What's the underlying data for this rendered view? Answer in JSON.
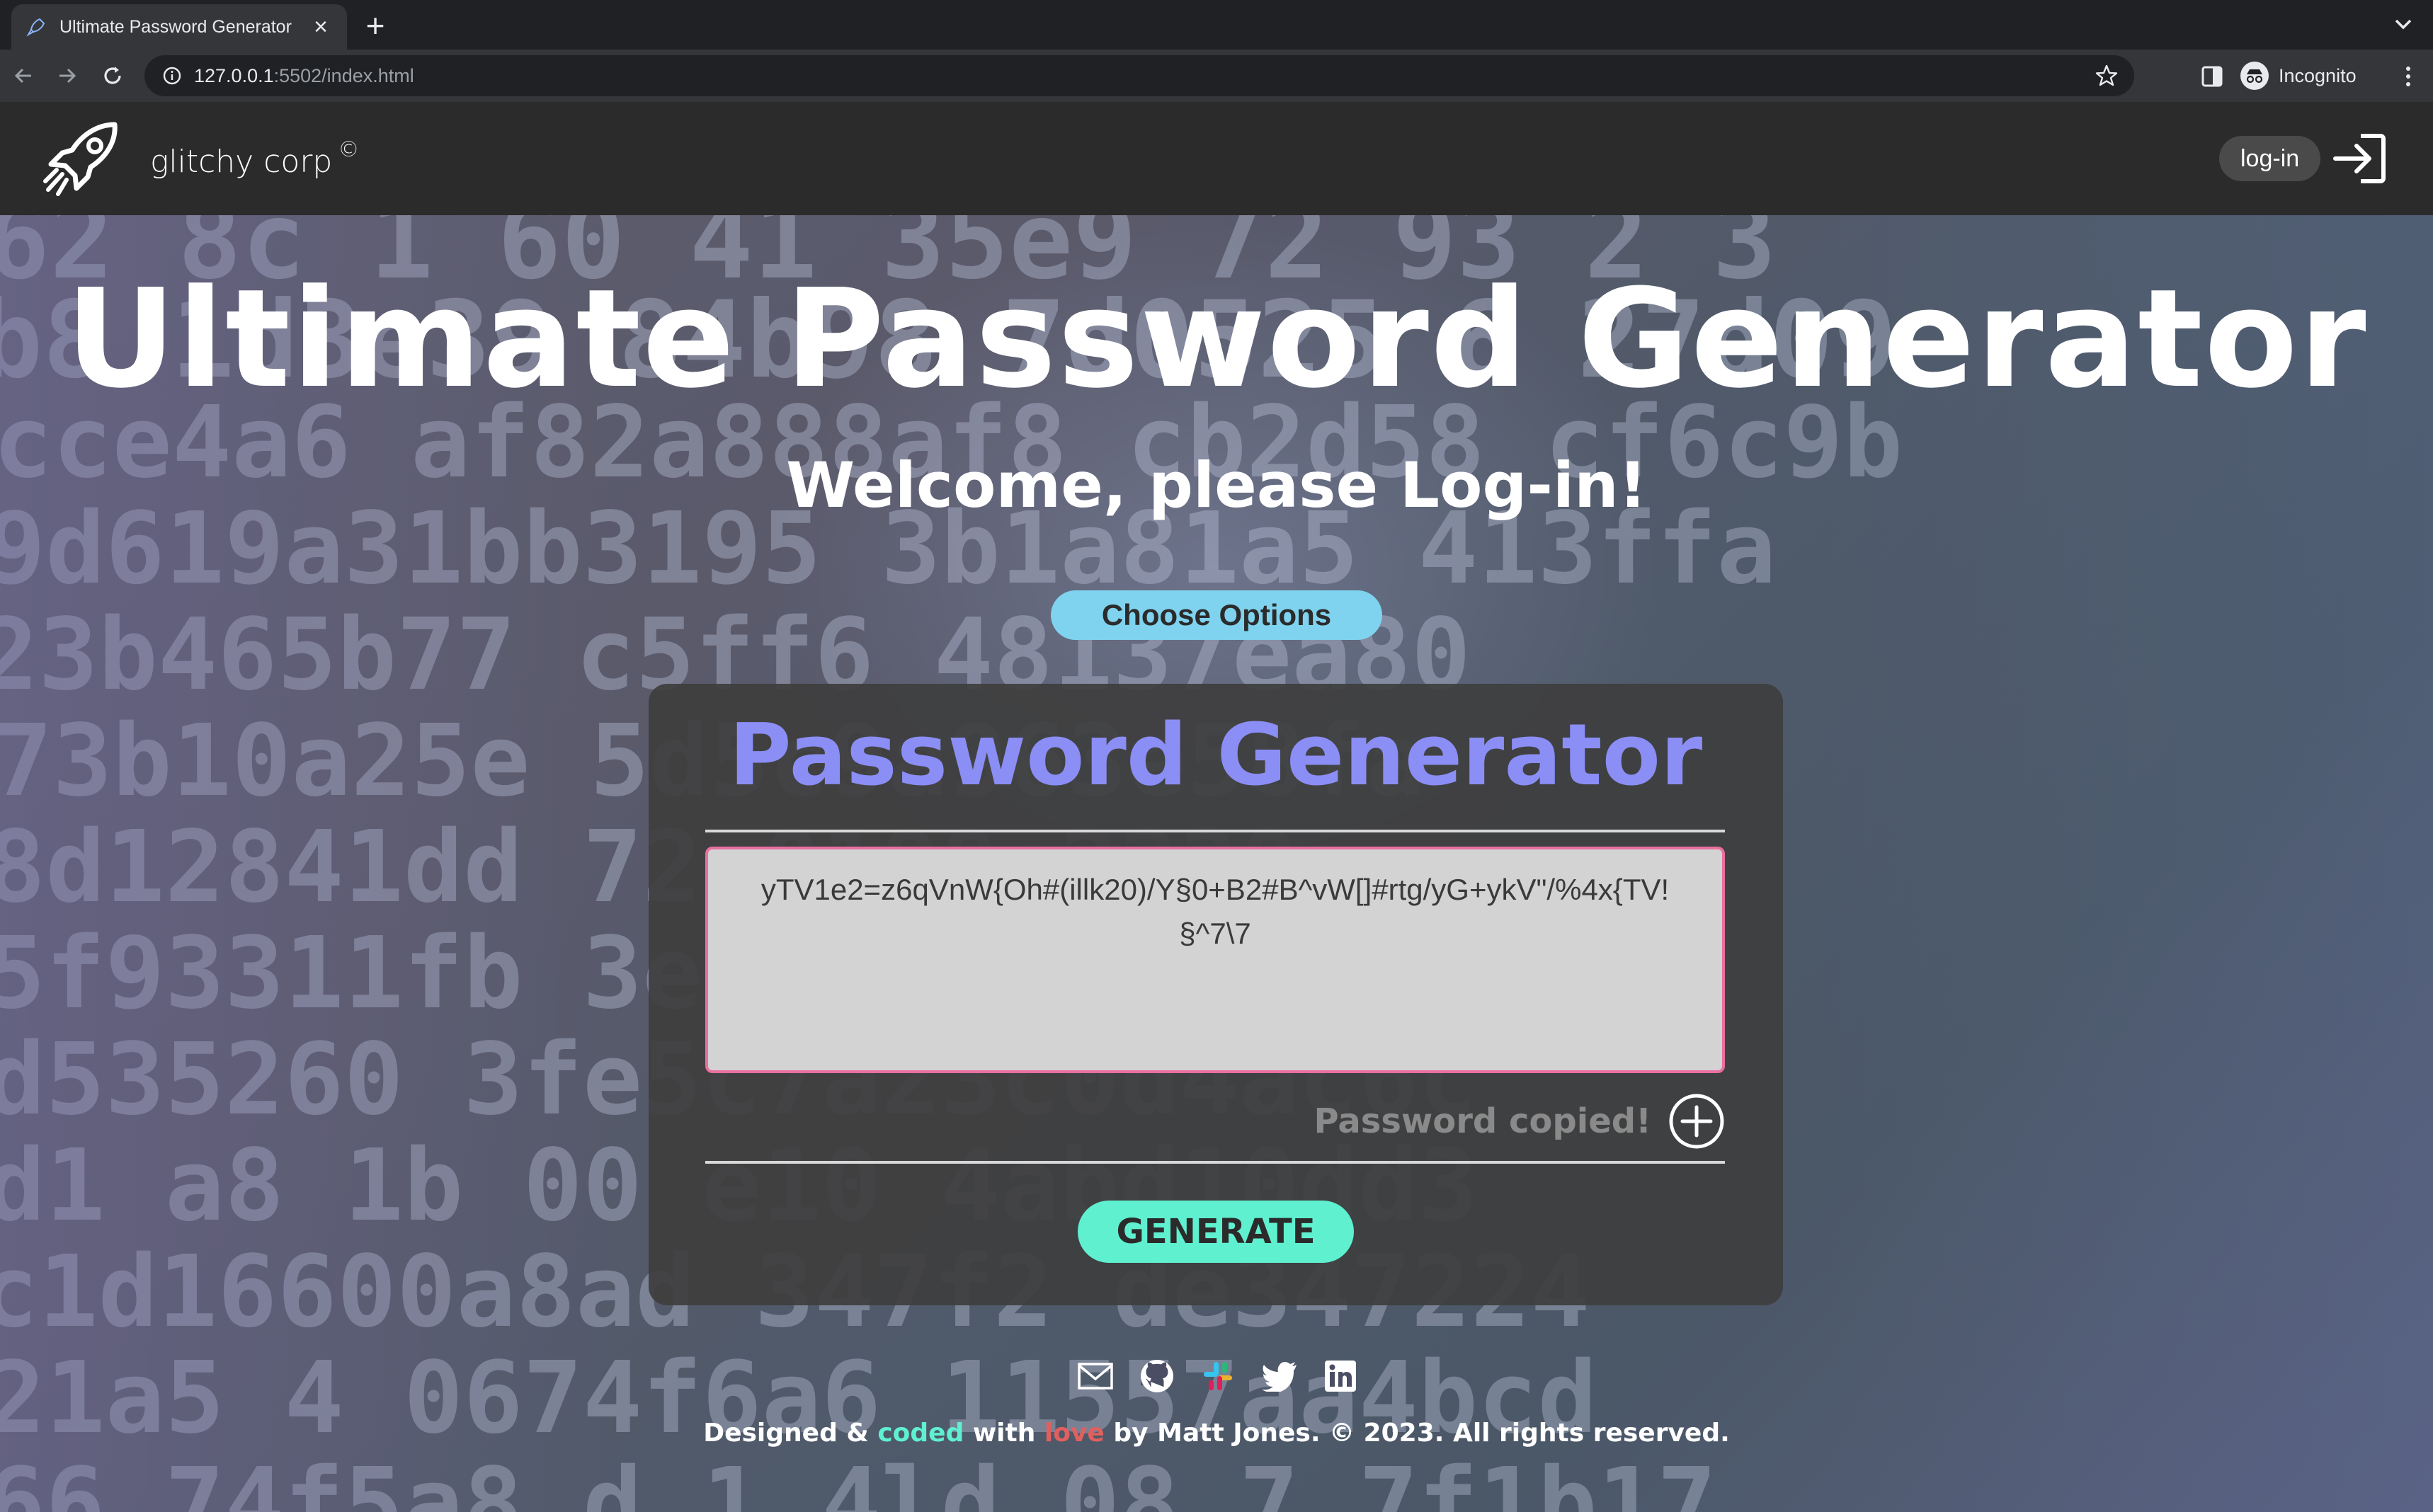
{
  "browser": {
    "tab_title": "Ultimate Password Generator",
    "url_host": "127.0.0.1",
    "url_rest": ":5502/index.html",
    "profile_label": "Incognito",
    "icons": [
      "rocket-favicon",
      "close-icon",
      "plus-icon",
      "chevron-down-icon",
      "back-arrow-icon",
      "forward-arrow-icon",
      "reload-icon",
      "info-icon",
      "star-icon",
      "side-panel-icon",
      "incognito-icon",
      "kebab-menu-icon"
    ]
  },
  "header": {
    "brand": "glitchy corp",
    "brand_mark": "©",
    "login_label": "log-in"
  },
  "hero": {
    "title": "Ultimate Password Generator",
    "subtitle": "Welcome, please Log-in!",
    "choose_options_label": "Choose Options"
  },
  "generator": {
    "title": "Password Generator",
    "password": "yTV1e2=z6qVnW{Oh#(illk20)/Y§0+B2#B^vW[]#rtg/yG+ykV\"/%4x{TV!§^7\\7",
    "copied_label": "Password copied!",
    "generate_label": "GENERATE"
  },
  "footer": {
    "socials": [
      "mail-icon",
      "github-icon",
      "slack-icon",
      "twitter-icon",
      "linkedin-icon"
    ],
    "text_designed": "Designed & ",
    "text_coded": "coded",
    "text_with": " with ",
    "text_love": "love",
    "text_rest": " by Matt Jones. © 2023. All rights reserved."
  },
  "colors": {
    "accent_title": "#8b8ef5",
    "generate_bg": "#5ff0d0",
    "choose_bg": "#7fd3ee",
    "textarea_border": "#e86f9f",
    "love": "#e0605f"
  }
}
